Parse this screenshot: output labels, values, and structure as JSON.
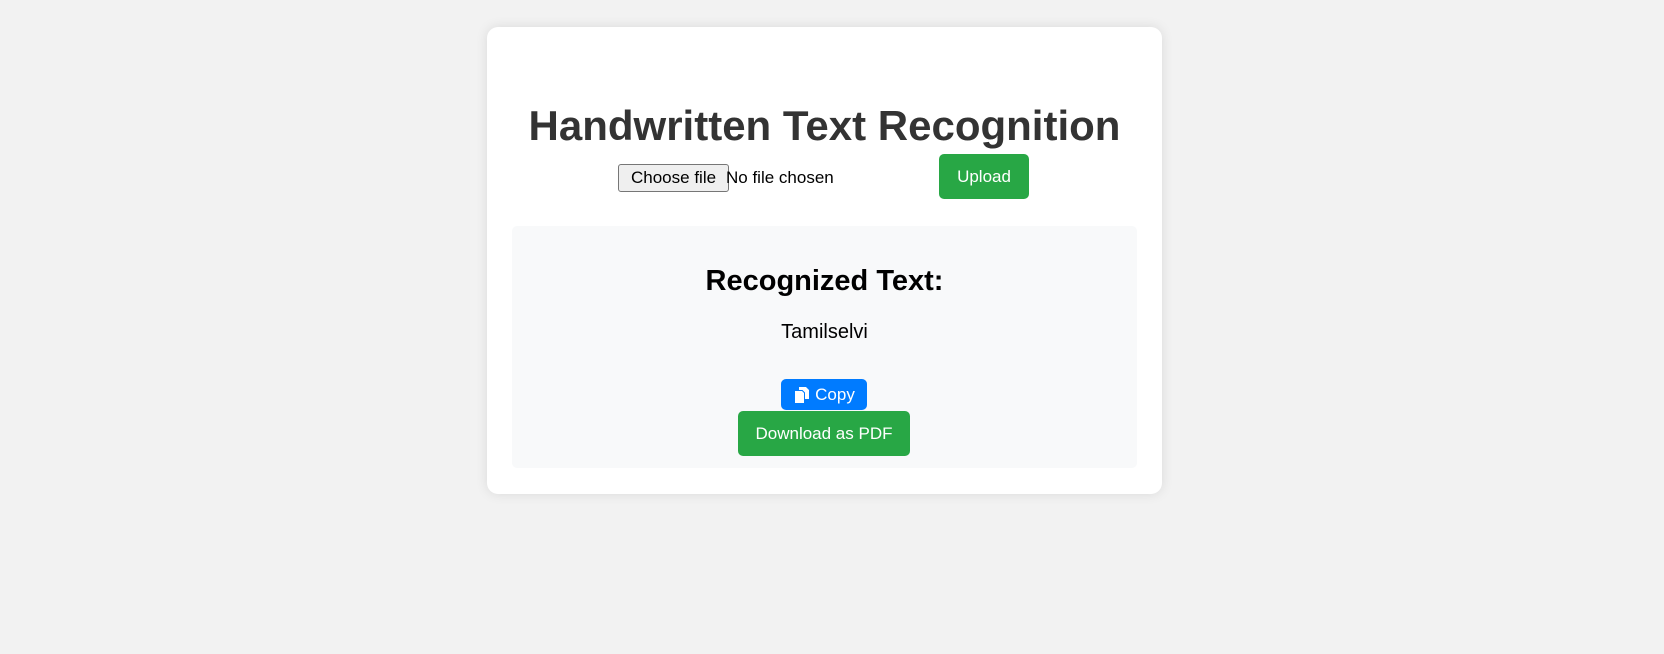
{
  "page": {
    "title": "Handwritten Text Recognition"
  },
  "upload": {
    "choose_file_label": "Choose file",
    "file_status": "No file chosen",
    "upload_label": "Upload"
  },
  "result": {
    "heading": "Recognized Text:",
    "text": "Tamilselvi",
    "copy_label": "Copy",
    "copy_icon": "copy-icon",
    "download_pdf_label": "Download as PDF"
  },
  "colors": {
    "background": "#f2f2f2",
    "card": "#ffffff",
    "title_text": "#333333",
    "success_green": "#28a745",
    "primary_blue": "#007bff",
    "result_box": "#f8f9fa"
  }
}
